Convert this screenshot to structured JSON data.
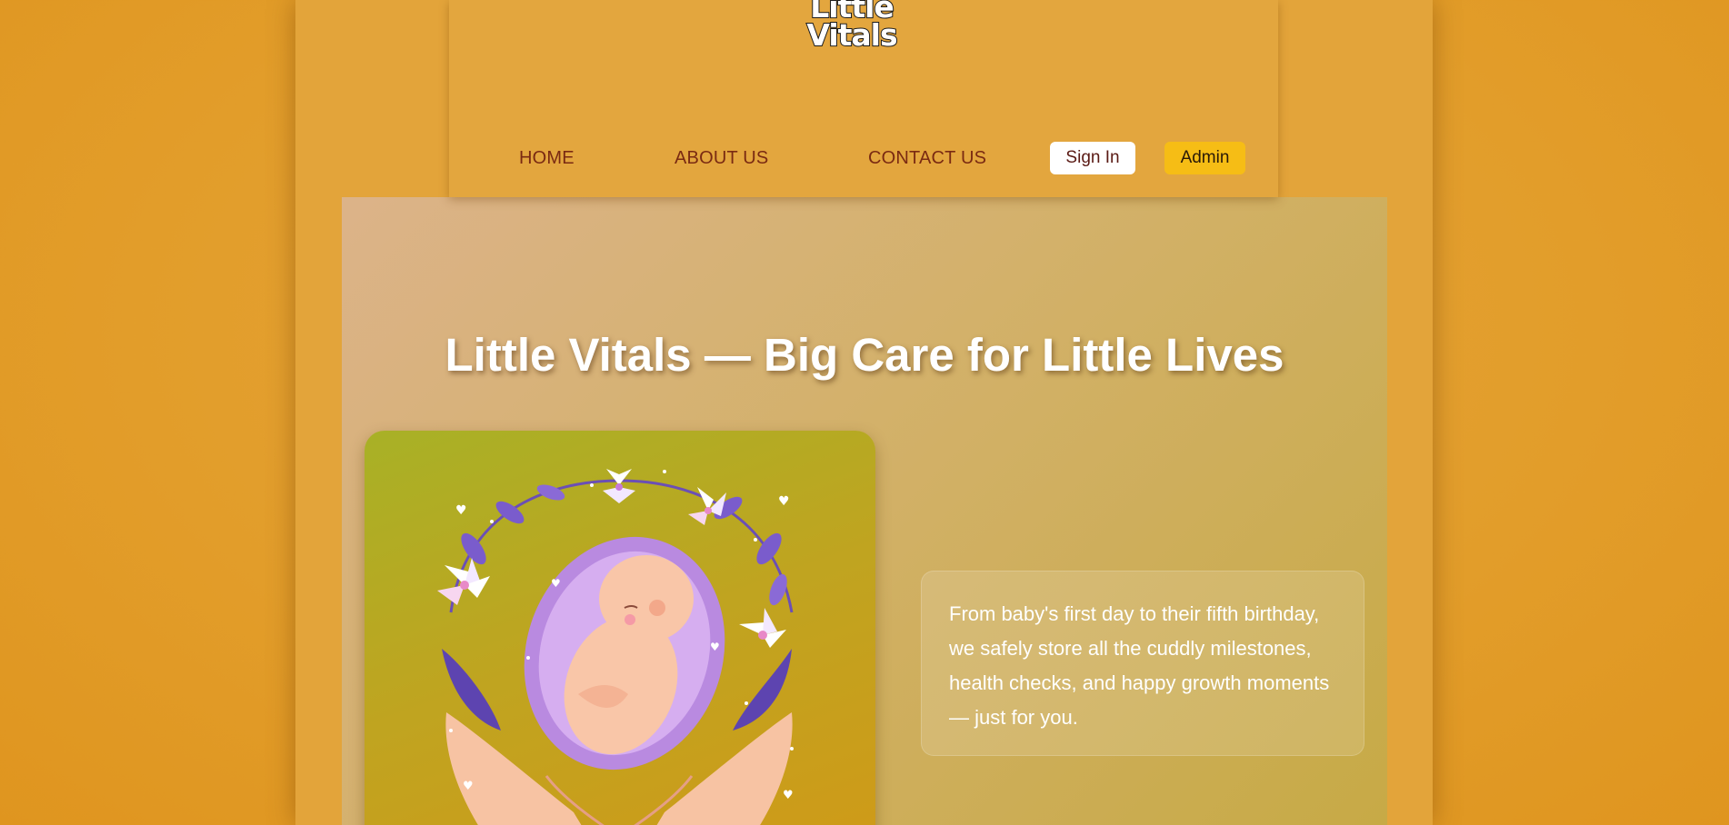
{
  "brand": {
    "logo_line1": "Little",
    "logo_line2": "Vitals"
  },
  "nav": {
    "home": "HOME",
    "about": "ABOUT US",
    "contact": "CONTACT US",
    "sign_in": "Sign In",
    "admin": "Admin"
  },
  "hero": {
    "title": "Little Vitals — Big Care for Little Lives",
    "description": "From baby's first day to their fifth birthday, we safely store all the cuddly milestones, health checks, and happy growth moments — just for you."
  },
  "colors": {
    "background": "#e29d2a",
    "header": "#e3a63e",
    "nav_text": "#7a2a12",
    "admin_button": "#f6bd15",
    "hero_overlay": "#d3b16a"
  },
  "icons": {
    "illustration": "baby-in-womb-with-hands-and-flowers"
  }
}
